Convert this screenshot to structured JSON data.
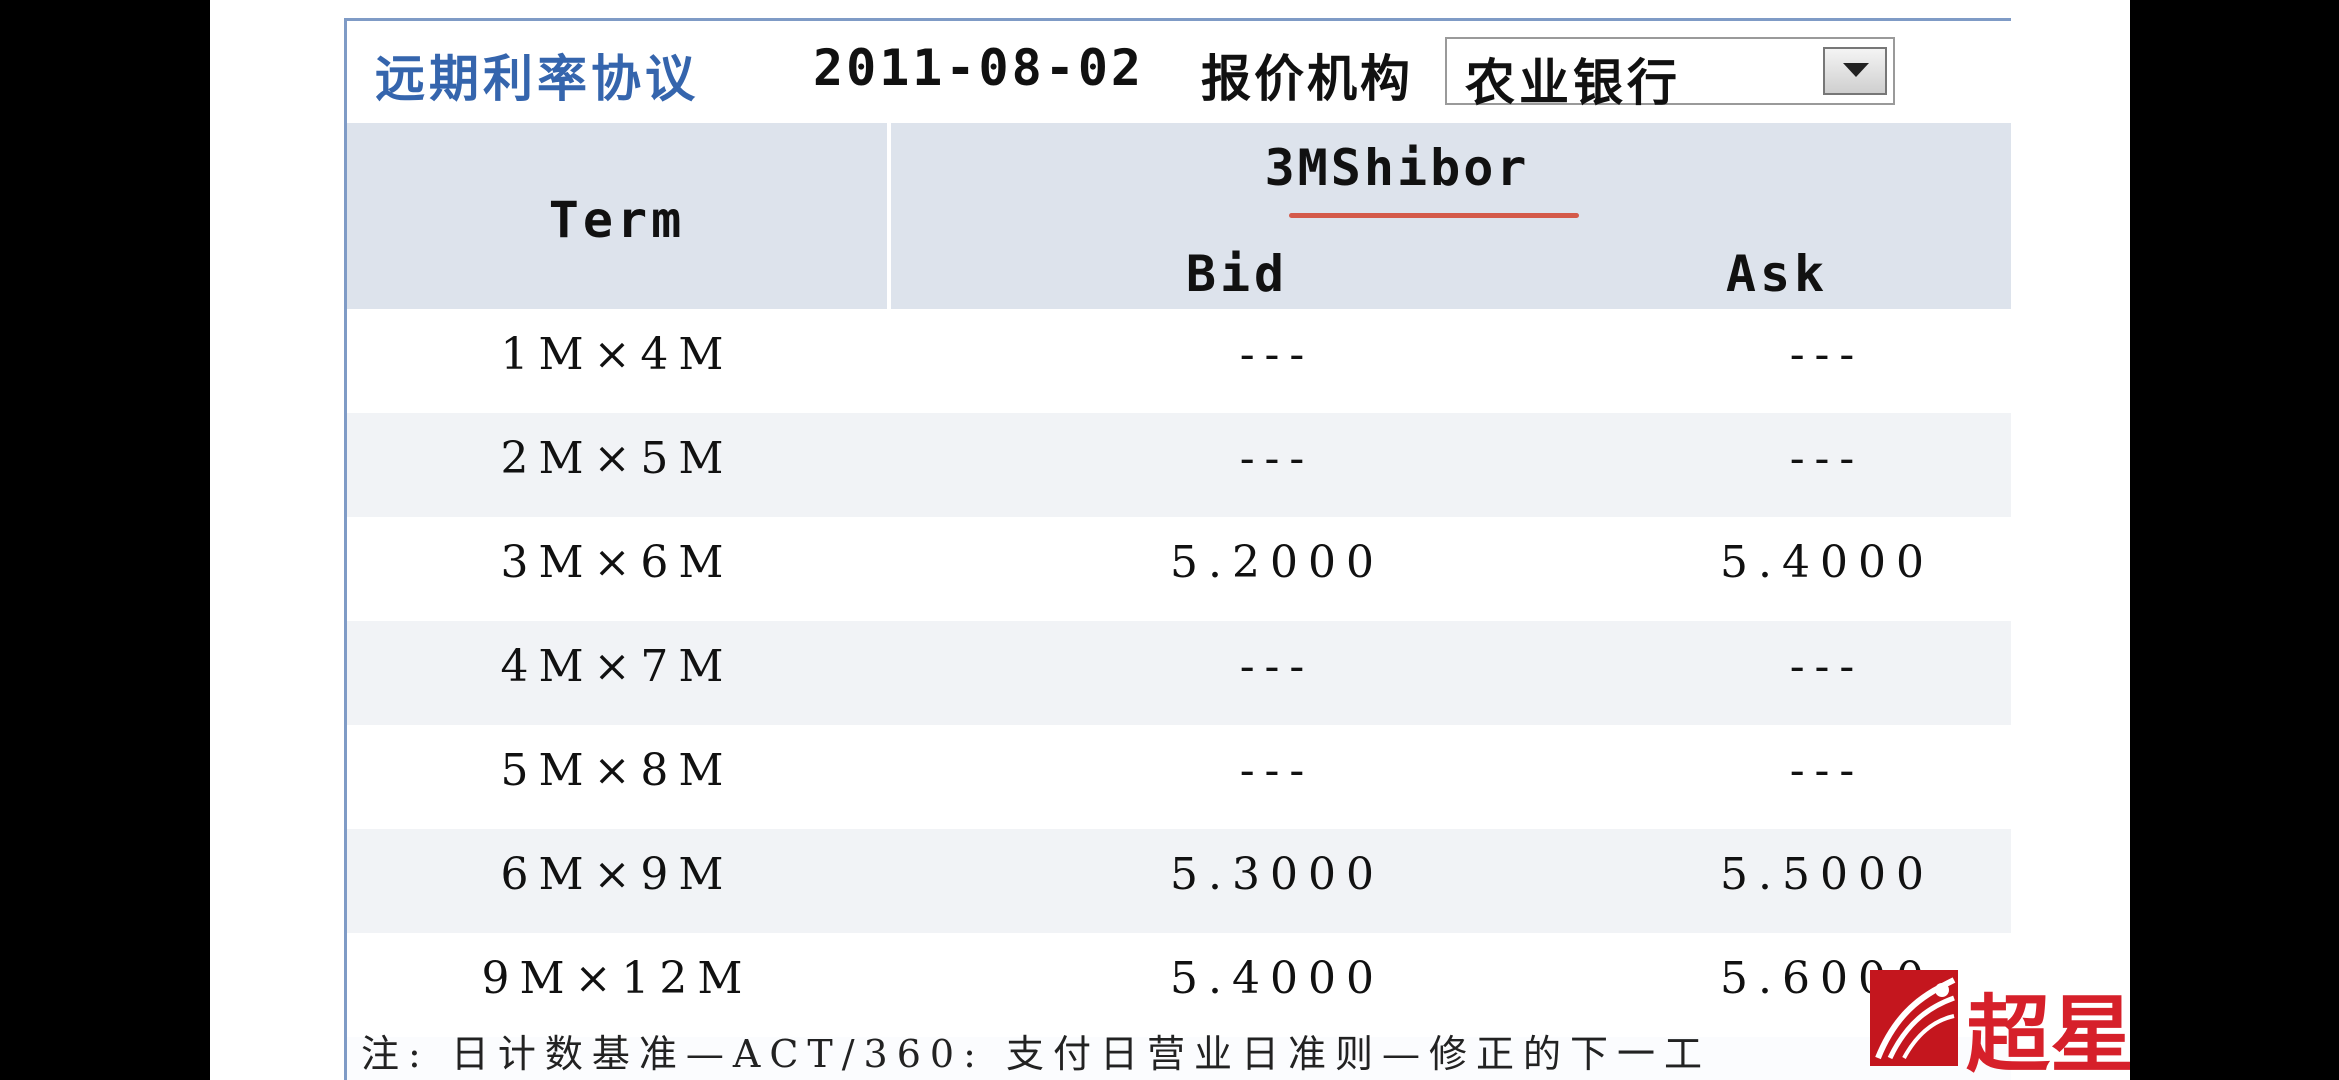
{
  "header": {
    "title": "远期利率协议",
    "date": "2011-08-02",
    "quoter_label": "报价机构",
    "quoter_select_value": "农业银行"
  },
  "table": {
    "col_term": "Term",
    "group_header": "3MShibor",
    "col_bid": "Bid",
    "col_ask": "Ask",
    "rows": [
      {
        "term": "1M×4M",
        "bid": "---",
        "ask": "---"
      },
      {
        "term": "2M×5M",
        "bid": "---",
        "ask": "---"
      },
      {
        "term": "3M×6M",
        "bid": "5.2000",
        "ask": "5.4000"
      },
      {
        "term": "4M×7M",
        "bid": "---",
        "ask": "---"
      },
      {
        "term": "5M×8M",
        "bid": "---",
        "ask": "---"
      },
      {
        "term": "6M×9M",
        "bid": "5.3000",
        "ask": "5.5000"
      },
      {
        "term": "9M×12M",
        "bid": "5.4000",
        "ask": "5.6000"
      }
    ]
  },
  "footnote": "注: 日计数基准—ACT/360: 支付日营业日准则—修正的下一工",
  "watermark": {
    "text": "超星",
    "icon": "chaoxing-logo-icon"
  },
  "colors": {
    "title_blue": "#3565ad",
    "header_bg": "#dde3ec",
    "underline_red": "#d45a4a",
    "watermark_red": "#d6202a"
  }
}
